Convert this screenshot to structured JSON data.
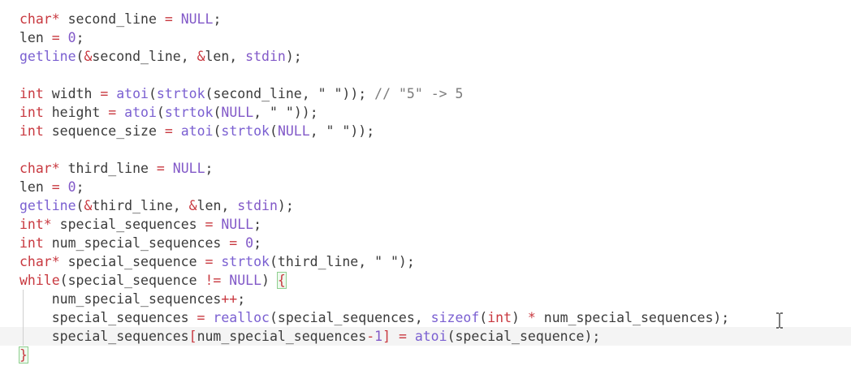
{
  "colors": {
    "background": "#ffffff",
    "keyword_type": "#c8383f",
    "function": "#7a5fd1",
    "constant": "#8259c8",
    "text": "#3b3b3b",
    "comment": "#7b7b7b",
    "current_line": "#f4f4f4",
    "brace_match": "#8fcf8f"
  },
  "cursor": {
    "icon": "text-ibeam-cursor-icon"
  },
  "editor": {
    "current_line_index": 17,
    "lines": [
      {
        "tokens": [
          {
            "t": "char*",
            "k": "type"
          },
          {
            "t": " second_line ",
            "k": "plain"
          },
          {
            "t": "=",
            "k": "op"
          },
          {
            "t": " ",
            "k": "plain"
          },
          {
            "t": "NULL",
            "k": "const"
          },
          {
            "t": ";",
            "k": "plain"
          }
        ]
      },
      {
        "tokens": [
          {
            "t": "len ",
            "k": "plain"
          },
          {
            "t": "=",
            "k": "op"
          },
          {
            "t": " ",
            "k": "plain"
          },
          {
            "t": "0",
            "k": "num"
          },
          {
            "t": ";",
            "k": "plain"
          }
        ]
      },
      {
        "tokens": [
          {
            "t": "getline",
            "k": "func"
          },
          {
            "t": "(",
            "k": "plain"
          },
          {
            "t": "&",
            "k": "op"
          },
          {
            "t": "second_line, ",
            "k": "plain"
          },
          {
            "t": "&",
            "k": "op"
          },
          {
            "t": "len, ",
            "k": "plain"
          },
          {
            "t": "stdin",
            "k": "const"
          },
          {
            "t": ");",
            "k": "plain"
          }
        ]
      },
      {
        "tokens": []
      },
      {
        "tokens": [
          {
            "t": "int",
            "k": "type"
          },
          {
            "t": " width ",
            "k": "plain"
          },
          {
            "t": "=",
            "k": "op"
          },
          {
            "t": " ",
            "k": "plain"
          },
          {
            "t": "atoi",
            "k": "func"
          },
          {
            "t": "(",
            "k": "plain"
          },
          {
            "t": "strtok",
            "k": "func"
          },
          {
            "t": "(second_line, \" \")); ",
            "k": "plain"
          },
          {
            "t": "// \"5\" -> 5",
            "k": "comment"
          }
        ]
      },
      {
        "tokens": [
          {
            "t": "int",
            "k": "type"
          },
          {
            "t": " height ",
            "k": "plain"
          },
          {
            "t": "=",
            "k": "op"
          },
          {
            "t": " ",
            "k": "plain"
          },
          {
            "t": "atoi",
            "k": "func"
          },
          {
            "t": "(",
            "k": "plain"
          },
          {
            "t": "strtok",
            "k": "func"
          },
          {
            "t": "(",
            "k": "plain"
          },
          {
            "t": "NULL",
            "k": "const"
          },
          {
            "t": ", \" \"));",
            "k": "plain"
          }
        ]
      },
      {
        "tokens": [
          {
            "t": "int",
            "k": "type"
          },
          {
            "t": " sequence_size ",
            "k": "plain"
          },
          {
            "t": "=",
            "k": "op"
          },
          {
            "t": " ",
            "k": "plain"
          },
          {
            "t": "atoi",
            "k": "func"
          },
          {
            "t": "(",
            "k": "plain"
          },
          {
            "t": "strtok",
            "k": "func"
          },
          {
            "t": "(",
            "k": "plain"
          },
          {
            "t": "NULL",
            "k": "const"
          },
          {
            "t": ", \" \"));",
            "k": "plain"
          }
        ]
      },
      {
        "tokens": []
      },
      {
        "tokens": [
          {
            "t": "char*",
            "k": "type"
          },
          {
            "t": " third_line ",
            "k": "plain"
          },
          {
            "t": "=",
            "k": "op"
          },
          {
            "t": " ",
            "k": "plain"
          },
          {
            "t": "NULL",
            "k": "const"
          },
          {
            "t": ";",
            "k": "plain"
          }
        ]
      },
      {
        "tokens": [
          {
            "t": "len ",
            "k": "plain"
          },
          {
            "t": "=",
            "k": "op"
          },
          {
            "t": " ",
            "k": "plain"
          },
          {
            "t": "0",
            "k": "num"
          },
          {
            "t": ";",
            "k": "plain"
          }
        ]
      },
      {
        "tokens": [
          {
            "t": "getline",
            "k": "func"
          },
          {
            "t": "(",
            "k": "plain"
          },
          {
            "t": "&",
            "k": "op"
          },
          {
            "t": "third_line, ",
            "k": "plain"
          },
          {
            "t": "&",
            "k": "op"
          },
          {
            "t": "len, ",
            "k": "plain"
          },
          {
            "t": "stdin",
            "k": "const"
          },
          {
            "t": ");",
            "k": "plain"
          }
        ]
      },
      {
        "tokens": [
          {
            "t": "int*",
            "k": "type"
          },
          {
            "t": " special_sequences ",
            "k": "plain"
          },
          {
            "t": "=",
            "k": "op"
          },
          {
            "t": " ",
            "k": "plain"
          },
          {
            "t": "NULL",
            "k": "const"
          },
          {
            "t": ";",
            "k": "plain"
          }
        ]
      },
      {
        "tokens": [
          {
            "t": "int",
            "k": "type"
          },
          {
            "t": " num_special_sequences ",
            "k": "plain"
          },
          {
            "t": "=",
            "k": "op"
          },
          {
            "t": " ",
            "k": "plain"
          },
          {
            "t": "0",
            "k": "num"
          },
          {
            "t": ";",
            "k": "plain"
          }
        ]
      },
      {
        "tokens": [
          {
            "t": "char*",
            "k": "type"
          },
          {
            "t": " special_sequence ",
            "k": "plain"
          },
          {
            "t": "=",
            "k": "op"
          },
          {
            "t": " ",
            "k": "plain"
          },
          {
            "t": "strtok",
            "k": "func"
          },
          {
            "t": "(third_line, \" \");",
            "k": "plain"
          }
        ]
      },
      {
        "tokens": [
          {
            "t": "while",
            "k": "kw"
          },
          {
            "t": "(special_sequence ",
            "k": "plain"
          },
          {
            "t": "!=",
            "k": "op"
          },
          {
            "t": " ",
            "k": "plain"
          },
          {
            "t": "NULL",
            "k": "const"
          },
          {
            "t": ") ",
            "k": "plain"
          },
          {
            "t": "{",
            "k": "brace"
          }
        ]
      },
      {
        "indent": true,
        "tokens": [
          {
            "t": "    num_special_sequences",
            "k": "plain"
          },
          {
            "t": "++",
            "k": "op"
          },
          {
            "t": ";",
            "k": "plain"
          }
        ]
      },
      {
        "indent": true,
        "tokens": [
          {
            "t": "    special_sequences ",
            "k": "plain"
          },
          {
            "t": "=",
            "k": "op"
          },
          {
            "t": " ",
            "k": "plain"
          },
          {
            "t": "realloc",
            "k": "func"
          },
          {
            "t": "(special_sequences, ",
            "k": "plain"
          },
          {
            "t": "sizeof",
            "k": "func"
          },
          {
            "t": "(",
            "k": "plain"
          },
          {
            "t": "int",
            "k": "type"
          },
          {
            "t": ") ",
            "k": "plain"
          },
          {
            "t": "*",
            "k": "op"
          },
          {
            "t": " num_special_sequences);",
            "k": "plain"
          }
        ]
      },
      {
        "indent": true,
        "tokens": [
          {
            "t": "    special_sequences",
            "k": "plain"
          },
          {
            "t": "[",
            "k": "op"
          },
          {
            "t": "num_special_sequences",
            "k": "plain"
          },
          {
            "t": "-",
            "k": "op"
          },
          {
            "t": "1",
            "k": "num"
          },
          {
            "t": "]",
            "k": "op"
          },
          {
            "t": " ",
            "k": "plain"
          },
          {
            "t": "=",
            "k": "op"
          },
          {
            "t": " ",
            "k": "plain"
          },
          {
            "t": "atoi",
            "k": "func"
          },
          {
            "t": "(special_sequence);",
            "k": "plain"
          }
        ]
      },
      {
        "tokens": [
          {
            "t": "}",
            "k": "brace"
          }
        ]
      }
    ]
  }
}
